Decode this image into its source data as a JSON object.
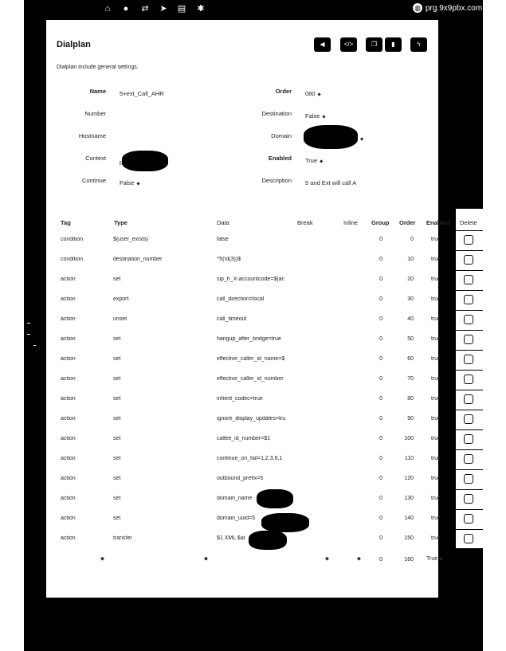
{
  "navbar": {
    "icons": [
      "home-icon",
      "user-icon",
      "transfer-icon",
      "send-icon",
      "chart-icon",
      "gear-icon"
    ],
    "icon_glyphs": [
      "⌂",
      "●",
      "⇄",
      "➤",
      "▤",
      "✱"
    ],
    "brand": "prg.9x9pbx.com",
    "globe_glyph": "◍"
  },
  "page": {
    "title": "Dialplan",
    "description": "Dialplan include general settings."
  },
  "toolbar": {
    "back_glyph": "◀",
    "xml_glyph": "</>",
    "copy_glyph": "❐",
    "delete_glyph": "▮",
    "save_glyph": "ϟ"
  },
  "form": {
    "name_label": "Name",
    "name_value": "5+ext_Call_AHR",
    "order_label": "Order",
    "order_value": "080",
    "number_label": "Number",
    "destination_label": "Destination",
    "destination_value": "False",
    "hostname_label": "Hostname",
    "domain_label": "Domain",
    "context_label": "Context",
    "context_value": "p",
    "enabled_label": "Enabled",
    "enabled_value": "True",
    "continue_label": "Continue",
    "continue_value": "False",
    "description_label": "Description",
    "description_value": "5 and Ext will call A",
    "select_glyph": "⬥"
  },
  "table": {
    "headers": {
      "tag": "Tag",
      "type": "Type",
      "data": "Data",
      "break": "Break",
      "inline": "Inline",
      "group": "Group",
      "order": "Order",
      "enabled": "Enabled",
      "delete": "Delete"
    },
    "rows": [
      {
        "tag": "condition",
        "type": "${user_exists}",
        "data": "false",
        "group": "0",
        "order": "0",
        "enabled": "true"
      },
      {
        "tag": "condition",
        "type": "destination_number",
        "data": "^5(\\d{3})$",
        "group": "0",
        "order": "10",
        "enabled": "true"
      },
      {
        "tag": "action",
        "type": "set",
        "data": "sip_h_X-accountcode=${ac",
        "group": "0",
        "order": "20",
        "enabled": "true"
      },
      {
        "tag": "action",
        "type": "export",
        "data": "call_direction=local",
        "group": "0",
        "order": "30",
        "enabled": "true"
      },
      {
        "tag": "action",
        "type": "unset",
        "data": "call_timeout",
        "group": "0",
        "order": "40",
        "enabled": "true"
      },
      {
        "tag": "action",
        "type": "set",
        "data": "hangup_after_bridge=true",
        "group": "0",
        "order": "50",
        "enabled": "true"
      },
      {
        "tag": "action",
        "type": "set",
        "data": "effective_caller_id_name=$",
        "group": "0",
        "order": "60",
        "enabled": "true"
      },
      {
        "tag": "action",
        "type": "set",
        "data": "effective_caller_id_number",
        "group": "0",
        "order": "70",
        "enabled": "true"
      },
      {
        "tag": "action",
        "type": "set",
        "data": "inherit_codec=true",
        "group": "0",
        "order": "80",
        "enabled": "true"
      },
      {
        "tag": "action",
        "type": "set",
        "data": "ignore_display_updates=tru",
        "group": "0",
        "order": "90",
        "enabled": "true"
      },
      {
        "tag": "action",
        "type": "set",
        "data": "callee_id_number=$1",
        "group": "0",
        "order": "100",
        "enabled": "true"
      },
      {
        "tag": "action",
        "type": "set",
        "data": "continue_on_fail=1,2,3,6,1",
        "group": "0",
        "order": "110",
        "enabled": "true"
      },
      {
        "tag": "action",
        "type": "set",
        "data": "outbound_prefix=5",
        "group": "0",
        "order": "120",
        "enabled": "true"
      },
      {
        "tag": "action",
        "type": "set",
        "data": "domain_name",
        "group": "0",
        "order": "130",
        "enabled": "true"
      },
      {
        "tag": "action",
        "type": "set",
        "data": "domain_uuid=5",
        "group": "0",
        "order": "140",
        "enabled": "true"
      },
      {
        "tag": "action",
        "type": "transfer",
        "data": "$1 XML $at",
        "group": "0",
        "order": "150",
        "enabled": "true"
      }
    ],
    "new_row": {
      "group": "0",
      "order": "160",
      "enabled": "True"
    }
  }
}
